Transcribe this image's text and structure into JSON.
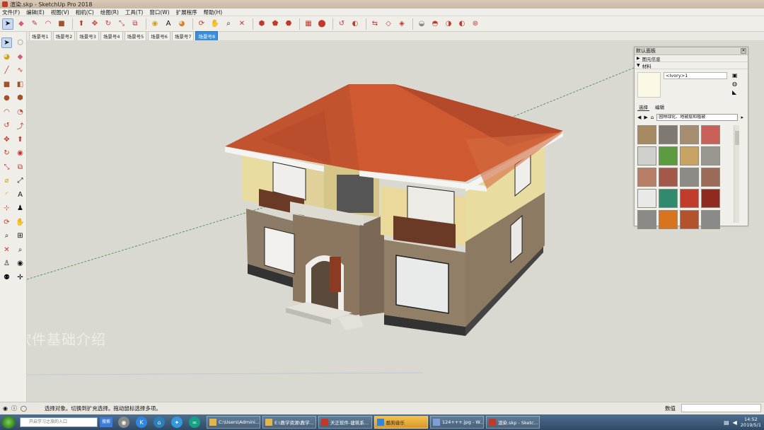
{
  "window": {
    "title": "渲染.skp - SketchUp Pro 2018"
  },
  "menu": [
    "文件(F)",
    "编辑(E)",
    "视图(V)",
    "相机(C)",
    "绘图(R)",
    "工具(T)",
    "窗口(W)",
    "扩展程序",
    "帮助(H)"
  ],
  "scene_tabs": [
    "场景号1",
    "场景号2",
    "场景号3",
    "场景号4",
    "场景号5",
    "场景号6",
    "场景号7",
    "场景号8"
  ],
  "active_scene_index": 7,
  "toolbar_icons": [
    "select-icon",
    "eraser-icon",
    "pencil-icon",
    "arc-icon",
    "rectangle-icon",
    "push-pull-icon",
    "move-icon",
    "rotate-icon",
    "scale-icon",
    "offset-icon",
    "tape-measure-icon",
    "text-icon",
    "paint-bucket-icon",
    "orbit-icon",
    "pan-icon",
    "zoom-icon",
    "zoom-extents-icon",
    "iso-view-icon",
    "top-view-icon",
    "front-view-icon",
    "right-view-icon",
    "back-view-icon",
    "left-view-icon",
    "shadow-icon",
    "section-icon",
    "warehouse-icon",
    "extension-icon",
    "style-icon",
    "layer-icon",
    "xray-icon",
    "wireframe-icon",
    "hidden-line-icon",
    "shaded-icon",
    "texture-icon",
    "monochrome-icon"
  ],
  "watermark": "软件基础介绍",
  "tray": {
    "title": "默认面板",
    "sections": [
      {
        "label": "图元信息",
        "open": false
      },
      {
        "label": "材料",
        "open": true
      }
    ],
    "material_name": "<Ivory>1",
    "tabs": [
      "选择",
      "编辑"
    ],
    "collection": "园林绿化、地被层和植被",
    "swatch_colors": [
      "#a58a62",
      "#7e7a72",
      "#a58e6f",
      "#c9615a",
      "#cfd2cc",
      "#5c9a3f",
      "#c9a361",
      "#9a9690",
      "#b77e65",
      "#a2594a",
      "#8e8a85",
      "#9c6b58",
      "#e9e9e7",
      "#2f8a6e",
      "#c23c2e",
      "#8e2a20",
      "#8c8a86",
      "#d9741e",
      "#b3522c",
      "#8a8a88"
    ]
  },
  "status": {
    "text": "选择对象。切换到扩充选择。拖动鼠标选择多项。",
    "measure_label": "数值"
  },
  "taskbar": {
    "search_placeholder": "开启学习之旅的入口",
    "search_button": "搜索",
    "tasks": [
      {
        "label": "C:\\Users\\Admini...",
        "color": "#e2b64a",
        "highlight": false
      },
      {
        "label": "E:\\教学资源\\教学...",
        "color": "#e2b64a",
        "highlight": false
      },
      {
        "label": "天正软件-建筑系...",
        "color": "#c0392b",
        "highlight": false
      },
      {
        "label": "酷狗音乐",
        "color": "#2e86de",
        "highlight": true
      },
      {
        "label": "124+++.jpg - W...",
        "color": "#7d9fd6",
        "highlight": false
      },
      {
        "label": "渲染.skp - Sketc...",
        "color": "#c0392b",
        "highlight": false
      }
    ],
    "time": "14:52",
    "date": "2019/5/1"
  }
}
